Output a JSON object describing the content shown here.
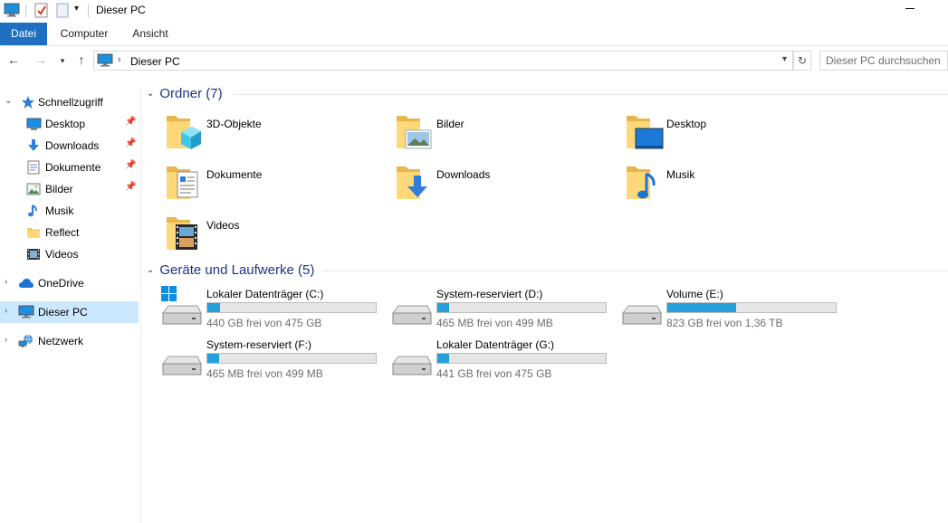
{
  "window": {
    "title": "Dieser PC"
  },
  "ribbon": {
    "tabs": [
      "Datei",
      "Computer",
      "Ansicht"
    ]
  },
  "address": {
    "crumb": "Dieser PC"
  },
  "search": {
    "placeholder": "Dieser PC durchsuchen"
  },
  "sidebar": {
    "quick_access": "Schnellzugriff",
    "quick_items": [
      {
        "label": "Desktop",
        "icon": "desktop-icon",
        "pinned": true
      },
      {
        "label": "Downloads",
        "icon": "downloads-icon",
        "pinned": true
      },
      {
        "label": "Dokumente",
        "icon": "documents-icon",
        "pinned": true
      },
      {
        "label": "Bilder",
        "icon": "pictures-icon",
        "pinned": true
      },
      {
        "label": "Musik",
        "icon": "music-icon",
        "pinned": false
      },
      {
        "label": "Reflect",
        "icon": "folder-icon",
        "pinned": false
      },
      {
        "label": "Videos",
        "icon": "videos-icon",
        "pinned": false
      }
    ],
    "onedrive": "OneDrive",
    "this_pc": "Dieser PC",
    "network": "Netzwerk"
  },
  "folders": {
    "heading": "Ordner (7)",
    "items": [
      {
        "label": "3D-Objekte",
        "overlay": "cube"
      },
      {
        "label": "Bilder",
        "overlay": "picture"
      },
      {
        "label": "Desktop",
        "overlay": "desktop"
      },
      {
        "label": "Dokumente",
        "overlay": "document"
      },
      {
        "label": "Downloads",
        "overlay": "download"
      },
      {
        "label": "Musik",
        "overlay": "music"
      },
      {
        "label": "Videos",
        "overlay": "video"
      }
    ]
  },
  "drives": {
    "heading": "Geräte und Laufwerke (5)",
    "items": [
      {
        "label": "Lokaler Datenträger (C:)",
        "free": "440 GB frei von 475 GB",
        "used_fraction": 0.074,
        "windows": true
      },
      {
        "label": "System-reserviert (D:)",
        "free": "465 MB frei von 499 MB",
        "used_fraction": 0.068,
        "windows": false
      },
      {
        "label": "Volume (E:)",
        "free": "823 GB frei von 1,36 TB",
        "used_fraction": 0.41,
        "windows": false
      },
      {
        "label": "System-reserviert (F:)",
        "free": "465 MB frei von 499 MB",
        "used_fraction": 0.068,
        "windows": false
      },
      {
        "label": "Lokaler Datenträger (G:)",
        "free": "441 GB frei von 475 GB",
        "used_fraction": 0.072,
        "windows": false
      }
    ]
  },
  "colors": {
    "accent": "#1e6fc1",
    "bar_fill": "#26a0da",
    "selection": "#cce8ff",
    "heading": "#1e3287"
  }
}
